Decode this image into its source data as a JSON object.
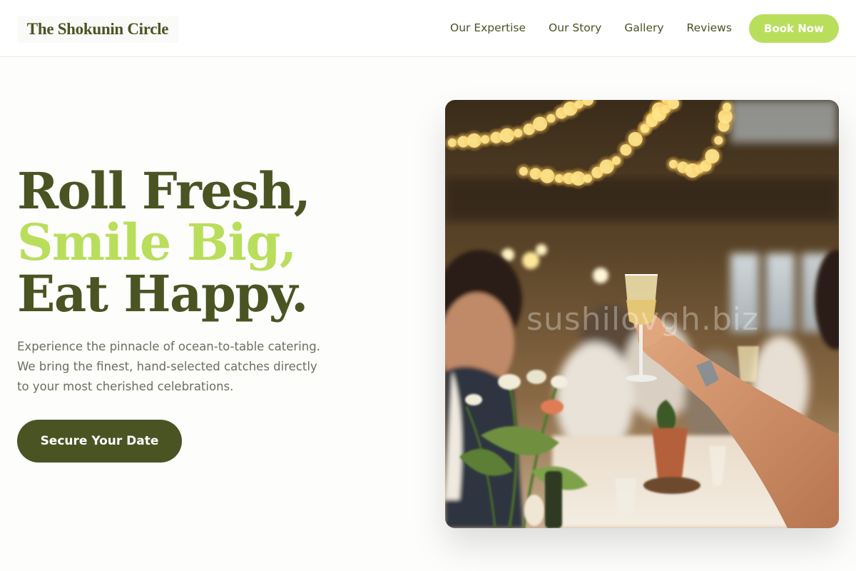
{
  "header": {
    "logo": "The Shokunin Circle",
    "nav": [
      {
        "label": "Our Expertise"
      },
      {
        "label": "Our Story"
      },
      {
        "label": "Gallery"
      },
      {
        "label": "Reviews"
      }
    ],
    "book_label": "Book Now"
  },
  "hero": {
    "headline": {
      "line1": "Roll Fresh,",
      "line2": "Smile Big,",
      "line3": "Eat Happy."
    },
    "subtitle": {
      "line1": "Experience the pinnacle of ocean-to-table catering.",
      "line2": "We bring the finest, hand-selected catches directly",
      "line3": "to your most cherished celebrations."
    },
    "cta_label": "Secure Your Date",
    "image": {
      "subject": "event-toast-photo",
      "watermark": "sushilovgh.biz"
    }
  },
  "colors": {
    "brand_dark": "#4a5423",
    "brand_accent": "#b9de5c",
    "body_text": "#6b6f5c",
    "background": "#fdfdfc"
  }
}
